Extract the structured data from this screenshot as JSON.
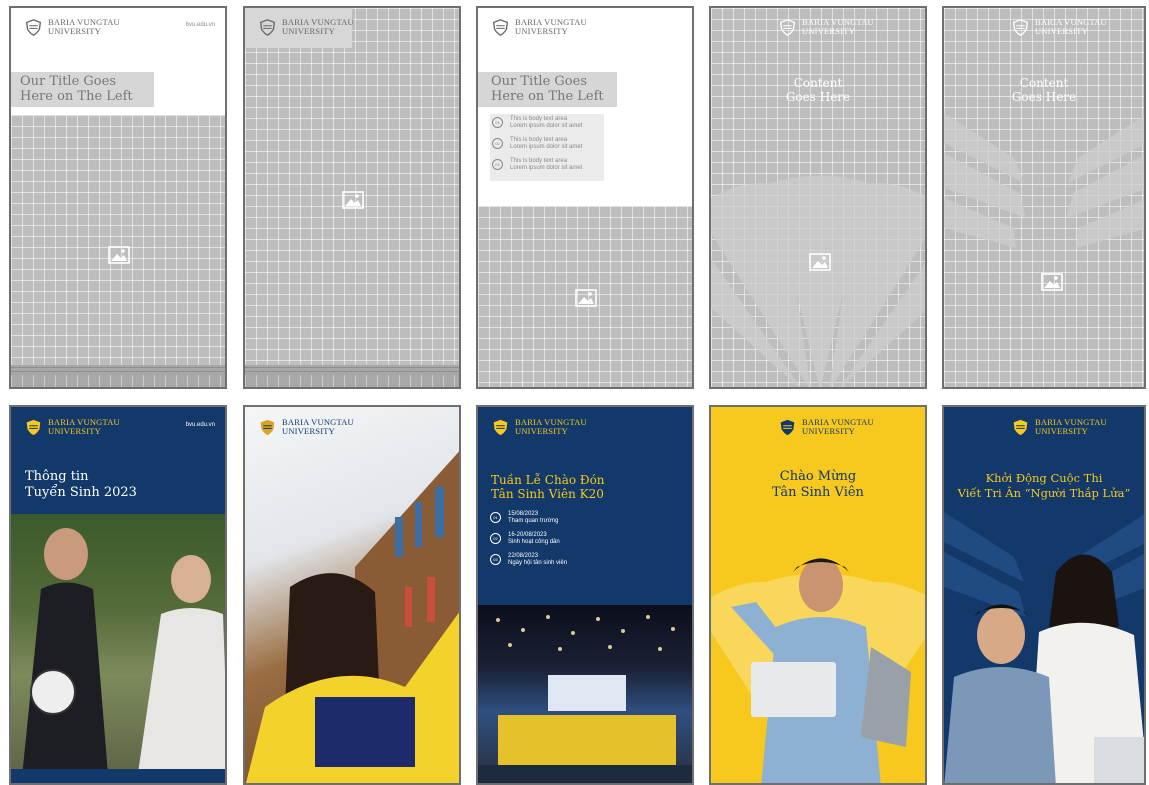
{
  "brand": {
    "logo_lines": "BARIA VUNGTAU\nUNIVERSITY",
    "website": "bvu.edu.vn",
    "navy": "#12396a",
    "yellow": "#f7c81d",
    "gold": "#d9a520",
    "wire_gray": "#bdbdbd"
  },
  "icons": {
    "crest": "university-crest-icon",
    "image_placeholder": "image-placeholder-icon"
  },
  "templates": [
    {
      "title": "Our Title Goes\nHere on The Left"
    },
    {},
    {
      "title": "Our Title Goes\nHere on The Left",
      "items": [
        {
          "num": "01",
          "text": "This is body text area\nLorem ipsum dolor sit amet"
        },
        {
          "num": "02",
          "text": "This is body text area\nLorem ipsum dolor sit amet"
        },
        {
          "num": "03",
          "text": "This is body text area\nLorem ipsum dolor sit amet"
        }
      ]
    },
    {
      "title": "Content\nGoes Here"
    },
    {
      "title": "Content\nGoes Here"
    }
  ],
  "designs": [
    {
      "title": "Thông tin\nTuyển Sinh 2023",
      "url": "bvu.edu.vn"
    },
    {},
    {
      "title": "Tuần Lễ Chào Đón\nTân Sinh Viên K20",
      "items": [
        {
          "num": "01",
          "text": "15/08/2023\nTham quan trường"
        },
        {
          "num": "02",
          "text": "16-20/08/2023\nSinh hoạt công dân"
        },
        {
          "num": "03",
          "text": "22/08/2023\nNgày hội tân sinh viên"
        }
      ]
    },
    {
      "title": "Chào Mừng\nTân Sinh Viên"
    },
    {
      "title": "Khởi Động Cuộc Thi\nViết Tri Ân “Người Thắp Lửa”"
    }
  ]
}
